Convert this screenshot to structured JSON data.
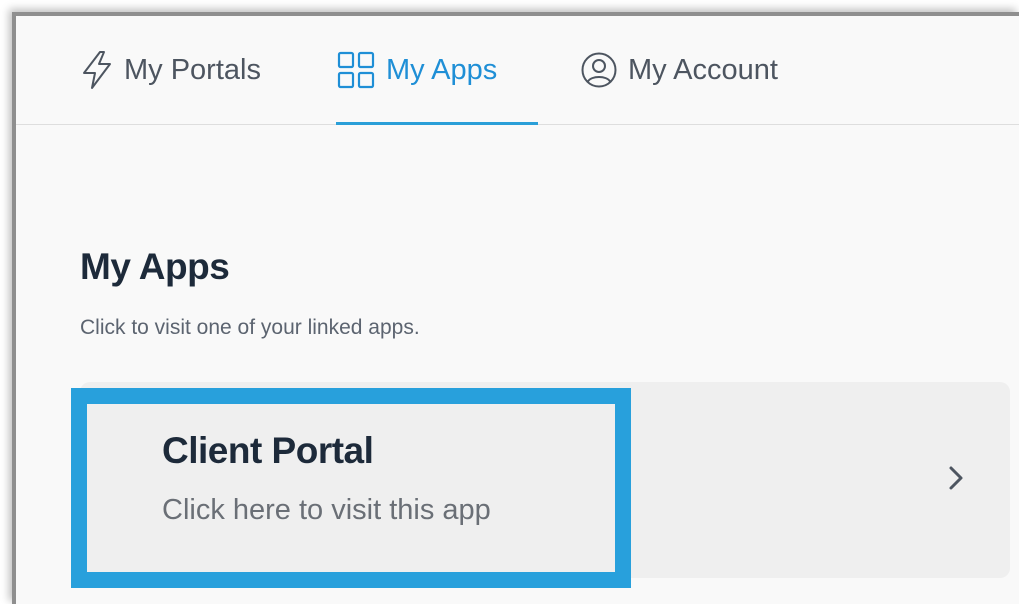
{
  "nav": {
    "tabs": [
      {
        "label": "My Portals",
        "icon": "lightning-bolt-icon",
        "active": false
      },
      {
        "label": "My Apps",
        "icon": "grid-icon",
        "active": true
      },
      {
        "label": "My Account",
        "icon": "user-circle-icon",
        "active": false
      }
    ]
  },
  "main": {
    "title": "My Apps",
    "subtitle": "Click to visit one of your linked apps.",
    "apps": [
      {
        "name": "Client Portal",
        "description": "Click here to visit this app",
        "icon": "chevron-right-icon"
      }
    ]
  },
  "colors": {
    "accent": "#1f8fd6",
    "highlight": "#28a0dc",
    "heading": "#1d2a3a"
  }
}
